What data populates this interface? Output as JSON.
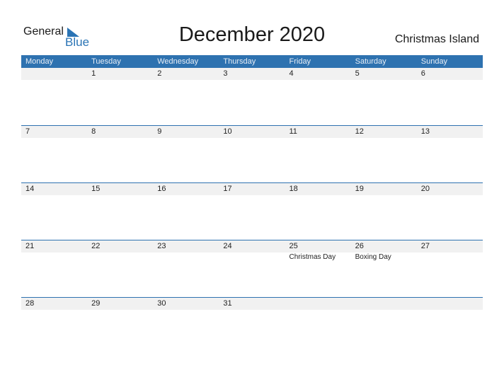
{
  "brand": {
    "general": "General",
    "blue": "Blue"
  },
  "title": "December 2020",
  "country": "Christmas Island",
  "weekdays": [
    "Monday",
    "Tuesday",
    "Wednesday",
    "Thursday",
    "Friday",
    "Saturday",
    "Sunday"
  ],
  "weeks": [
    {
      "days": [
        "",
        "1",
        "2",
        "3",
        "4",
        "5",
        "6"
      ],
      "events": [
        "",
        "",
        "",
        "",
        "",
        "",
        ""
      ]
    },
    {
      "days": [
        "7",
        "8",
        "9",
        "10",
        "11",
        "12",
        "13"
      ],
      "events": [
        "",
        "",
        "",
        "",
        "",
        "",
        ""
      ]
    },
    {
      "days": [
        "14",
        "15",
        "16",
        "17",
        "18",
        "19",
        "20"
      ],
      "events": [
        "",
        "",
        "",
        "",
        "",
        "",
        ""
      ]
    },
    {
      "days": [
        "21",
        "22",
        "23",
        "24",
        "25",
        "26",
        "27"
      ],
      "events": [
        "",
        "",
        "",
        "",
        "Christmas Day",
        "Boxing Day",
        ""
      ]
    },
    {
      "days": [
        "28",
        "29",
        "30",
        "31",
        "",
        "",
        ""
      ],
      "events": [
        "",
        "",
        "",
        "",
        "",
        "",
        ""
      ]
    }
  ]
}
